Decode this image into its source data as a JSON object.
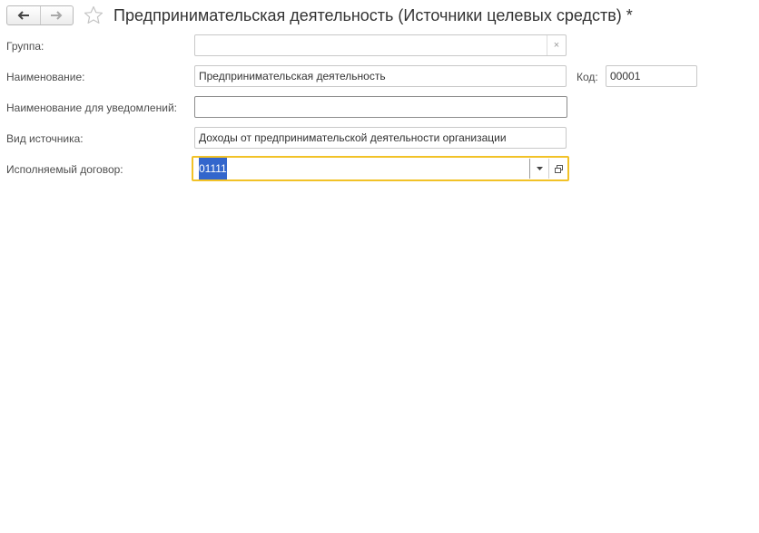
{
  "header": {
    "title": "Предпринимательская деятельность (Источники целевых средств) *"
  },
  "form": {
    "group": {
      "label": "Группа:",
      "value": ""
    },
    "name": {
      "label": "Наименование:",
      "value": "Предпринимательская деятельность"
    },
    "code": {
      "label": "Код:",
      "value": "00001"
    },
    "notification_name": {
      "label": "Наименование для уведомлений:",
      "value": ""
    },
    "source_type": {
      "label": "Вид источника:",
      "value": "Доходы от предпринимательской деятельности организации"
    },
    "contract": {
      "label": "Исполняемый договор:",
      "value": "01111"
    }
  },
  "colors": {
    "focus_border": "#f2c227",
    "selection": "#3366cc"
  }
}
